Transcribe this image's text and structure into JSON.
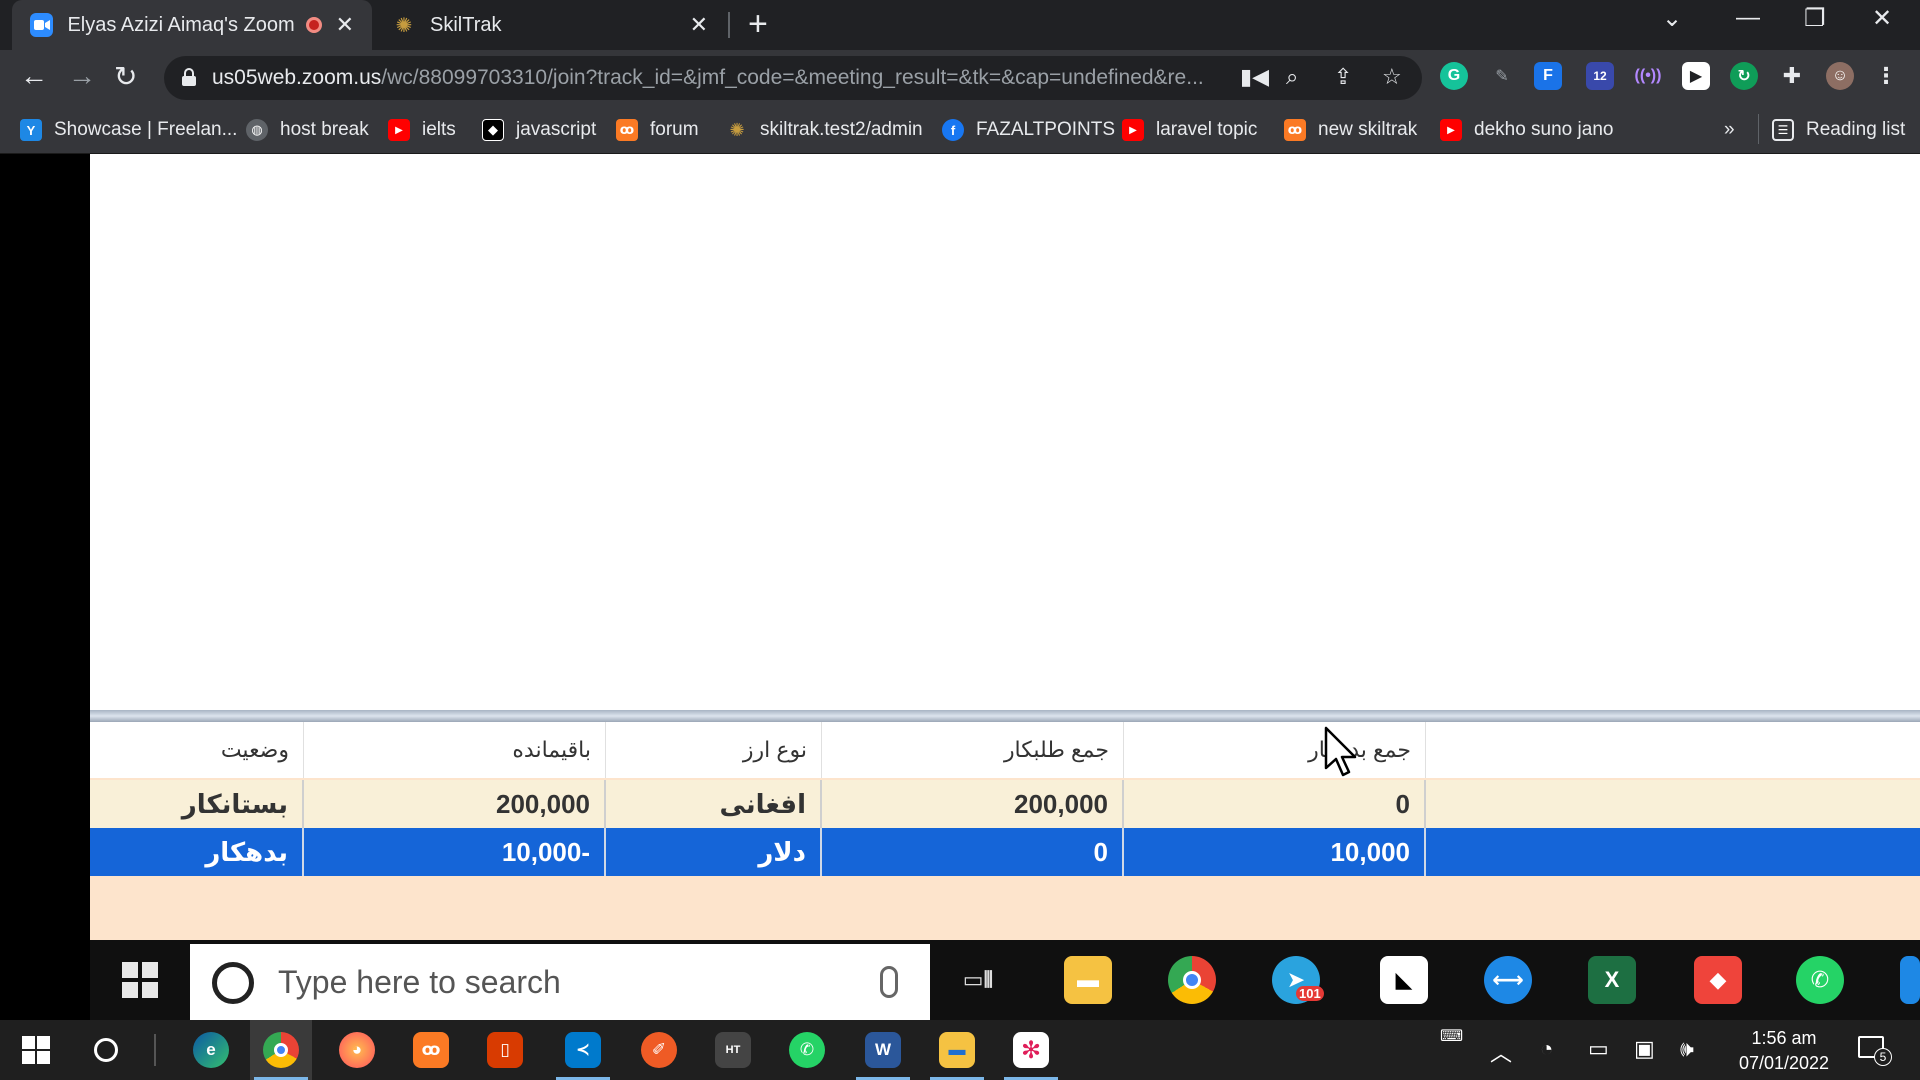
{
  "browser": {
    "tabs": [
      {
        "title": "Elyas Azizi Aimaq's Zoom Me",
        "icon": "zoom-icon",
        "active": true,
        "recording": true
      },
      {
        "title": "SkilTrak",
        "icon": "skiltrak-icon",
        "active": false
      }
    ],
    "url_host": "us05web.zoom.us",
    "url_path": "/wc/88099703310/join?track_id=&jmf_code=&meeting_result=&tk=&cap=undefined&re...",
    "extension_badge": "12",
    "bookmarks": [
      {
        "label": "Showcase | Freelan...",
        "icon": "upwork-y-icon",
        "color": "#1e88e5"
      },
      {
        "label": "host break",
        "icon": "globe-icon",
        "color": "#5f6368"
      },
      {
        "label": "ielts",
        "icon": "youtube-icon",
        "color": "#ff0000"
      },
      {
        "label": "javascript",
        "icon": "devto-icon",
        "color": "#000000"
      },
      {
        "label": "forum",
        "icon": "xampp-icon",
        "color": "#fb7a24"
      },
      {
        "label": "skiltrak.test2/admin",
        "icon": "skiltrak-icon",
        "color": "#c69c3f"
      },
      {
        "label": "FAZALTPOINTS",
        "icon": "facebook-icon",
        "color": "#1877f2"
      },
      {
        "label": "laravel topic",
        "icon": "youtube-icon",
        "color": "#ff0000"
      },
      {
        "label": "new skiltrak",
        "icon": "xampp-icon",
        "color": "#fb7a24"
      },
      {
        "label": "dekho suno jano",
        "icon": "youtube-icon",
        "color": "#ff0000"
      }
    ],
    "more_bookmarks": "»",
    "reading_list": "Reading list"
  },
  "shared_screen": {
    "table": {
      "headers": {
        "status": "وضعیت",
        "balance": "باقیمانده",
        "currency": "نوع ارز",
        "total_credit": "جمع طلبکار",
        "total_debit": "جمع بدهکار"
      },
      "rows": [
        {
          "status": "بستانکار",
          "balance": "200,000",
          "currency": "افغانی",
          "total_credit": "200,000",
          "total_debit": "0",
          "selected": false
        },
        {
          "status": "بدهکار",
          "balance": "10,000-",
          "currency": "دلار",
          "total_credit": "0",
          "total_debit": "10,000",
          "selected": true
        }
      ]
    },
    "inner_taskbar": {
      "search_placeholder": "Type here to search",
      "telegram_badge": "101"
    }
  },
  "taskbar": {
    "time": "1:56 am",
    "date": "07/01/2022",
    "notification_count": "5"
  },
  "colors": {
    "chrome_bg": "#202124",
    "toolbar_bg": "#35363a",
    "selected_row": "#1565d8",
    "grid_bg": "#fde4cc"
  }
}
